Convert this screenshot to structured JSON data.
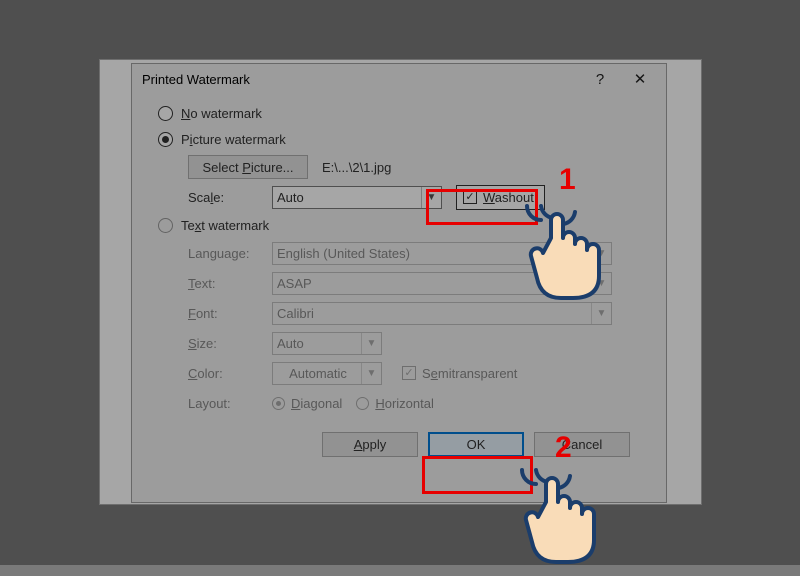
{
  "dialog": {
    "title": "Printed Watermark",
    "help_icon": "?",
    "close_icon": "✕",
    "no_watermark_label": "No watermark",
    "picture_watermark_label": "Picture watermark",
    "select_picture_label": "Select Picture...",
    "picture_path": "E:\\...\\2\\1.jpg",
    "scale_label": "Scale:",
    "scale_value": "Auto",
    "washout_label": "Washout",
    "text_watermark_label": "Text watermark",
    "language_label": "Language:",
    "language_value": "English (United States)",
    "text_label": "Text:",
    "text_value": "ASAP",
    "font_label": "Font:",
    "font_value": "Calibri",
    "size_label": "Size:",
    "size_value": "Auto",
    "color_label": "Color:",
    "color_value": "Automatic",
    "semitransparent_label": "Semitransparent",
    "layout_label": "Layout:",
    "layout_diagonal": "Diagonal",
    "layout_horizontal": "Horizontal",
    "apply_label": "Apply",
    "ok_label": "OK",
    "cancel_label": "Cancel"
  },
  "annotations": {
    "step1": "1",
    "step2": "2"
  }
}
